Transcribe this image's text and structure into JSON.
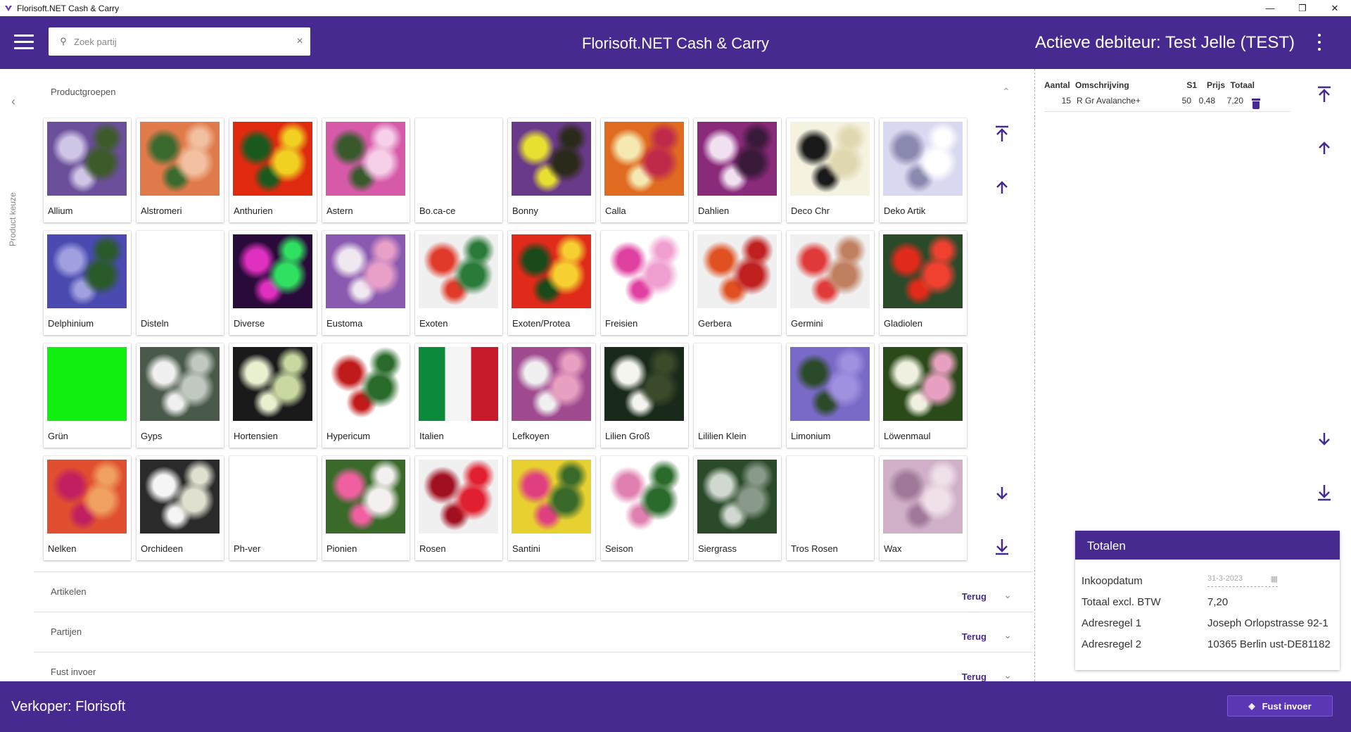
{
  "window": {
    "title": "Florisoft.NET Cash & Carry",
    "minimize": "—",
    "restore": "❐",
    "close": "✕"
  },
  "header": {
    "search_placeholder": "Zoek partij",
    "app_title": "Florisoft.NET Cash & Carry",
    "debiteur": "Actieve debiteur:  Test Jelle (TEST)"
  },
  "left_rail": {
    "label": "Product keuze"
  },
  "productgroepen": {
    "title": "Productgroepen",
    "groups": [
      {
        "label": "Allium",
        "thumb": "allium",
        "colors": [
          "#6b4f9a",
          "#cfc6e6",
          "#3d5a2a"
        ]
      },
      {
        "label": "Alstromeri",
        "thumb": "alstromeri",
        "colors": [
          "#e07a4a",
          "#3a6a2e",
          "#f2c0a0"
        ]
      },
      {
        "label": "Anthurien",
        "thumb": "anthurien",
        "colors": [
          "#e02a10",
          "#1a5a1e",
          "#f0d020"
        ]
      },
      {
        "label": "Astern",
        "thumb": "astern",
        "colors": [
          "#d65aa8",
          "#3a5a2e",
          "#f5d0e8"
        ]
      },
      {
        "label": "Bo.ca-ce",
        "thumb": "",
        "colors": []
      },
      {
        "label": "Bonny",
        "thumb": "bonny",
        "colors": [
          "#6a3a8a",
          "#e8e030",
          "#2a2a1a"
        ]
      },
      {
        "label": "Calla",
        "thumb": "calla",
        "colors": [
          "#e06a20",
          "#f5e8b0",
          "#c02a4a"
        ]
      },
      {
        "label": "Dahlien",
        "thumb": "dahlien",
        "colors": [
          "#8a2a7a",
          "#f0e0f0",
          "#3a1a3a"
        ]
      },
      {
        "label": "Deco Chr",
        "thumb": "decochr",
        "colors": [
          "#f5f2e0",
          "#1a1a1a",
          "#e0d8b0"
        ]
      },
      {
        "label": "Deko Artik",
        "thumb": "dekoartik",
        "colors": [
          "#d8d8f0",
          "#8a8ab0",
          "#ffffff"
        ]
      },
      {
        "label": "Delphinium",
        "thumb": "delphinium",
        "colors": [
          "#4a4ab0",
          "#a0a0e0",
          "#2a5a2a"
        ]
      },
      {
        "label": "Disteln",
        "thumb": "",
        "colors": []
      },
      {
        "label": "Diverse",
        "thumb": "diverse",
        "colors": [
          "#2a0a3a",
          "#e030c0",
          "#30e060"
        ]
      },
      {
        "label": "Eustoma",
        "thumb": "eustoma",
        "colors": [
          "#8a5ab0",
          "#f0e8f0",
          "#e8a0c8"
        ]
      },
      {
        "label": "Exoten",
        "thumb": "exoten",
        "colors": [
          "#f0f0f0",
          "#e03a2a",
          "#2a7a3a"
        ]
      },
      {
        "label": "Exoten/Protea",
        "thumb": "exotenprotea",
        "colors": [
          "#e02a1a",
          "#1a4a1a",
          "#f5d030"
        ]
      },
      {
        "label": "Freisien",
        "thumb": "freisien",
        "colors": [
          "#ffffff",
          "#e040a0",
          "#f0a0d0"
        ]
      },
      {
        "label": "Gerbera",
        "thumb": "gerbera",
        "colors": [
          "#f0f0f0",
          "#e05020",
          "#c02020"
        ]
      },
      {
        "label": "Germini",
        "thumb": "germini",
        "colors": [
          "#f0f0f0",
          "#e03a3a",
          "#c08060"
        ]
      },
      {
        "label": "Gladiolen",
        "thumb": "gladiolen",
        "colors": [
          "#2a4a2a",
          "#e02a1a",
          "#f04030"
        ]
      },
      {
        "label": "Grün",
        "thumb": "gruen",
        "colors": [
          "#10f010",
          "#10f010",
          "#10f010"
        ]
      },
      {
        "label": "Gyps",
        "thumb": "gyps",
        "colors": [
          "#4a5a4a",
          "#f0f0f0",
          "#c0c8c0"
        ]
      },
      {
        "label": "Hortensien",
        "thumb": "hortensien",
        "colors": [
          "#1a1a1a",
          "#e8f0d0",
          "#c8d8a0"
        ]
      },
      {
        "label": "Hypericum",
        "thumb": "hypericum",
        "colors": [
          "#ffffff",
          "#c01a1a",
          "#2a6a2a"
        ]
      },
      {
        "label": "Italien",
        "thumb": "italien",
        "colors": [
          "#0a8a3a",
          "#f5f5f5",
          "#c81a2a"
        ]
      },
      {
        "label": "Lefkoyen",
        "thumb": "lefkoyen",
        "colors": [
          "#a04a90",
          "#f0f0f0",
          "#e8a0c0"
        ]
      },
      {
        "label": "Lilien Groß",
        "thumb": "lilien",
        "colors": [
          "#1a2a1a",
          "#f5f5f0",
          "#3a4a2a"
        ]
      },
      {
        "label": "Lililien Klein",
        "thumb": "",
        "colors": []
      },
      {
        "label": "Limonium",
        "thumb": "limonium",
        "colors": [
          "#7a6ac8",
          "#2a4a2a",
          "#a090e0"
        ]
      },
      {
        "label": "Löwenmaul",
        "thumb": "loewenmaul",
        "colors": [
          "#2a4a1a",
          "#f0f0e0",
          "#e8a0c0"
        ]
      },
      {
        "label": "Nelken",
        "thumb": "nelken",
        "colors": [
          "#e05030",
          "#c02060",
          "#f0a060"
        ]
      },
      {
        "label": "Orchideen",
        "thumb": "orchideen",
        "colors": [
          "#2a2a2a",
          "#f5f5f5",
          "#e0e0d0"
        ]
      },
      {
        "label": "Ph-ver",
        "thumb": "",
        "colors": []
      },
      {
        "label": "Pionien",
        "thumb": "pionien",
        "colors": [
          "#3a6a2a",
          "#f060a0",
          "#f5f0f0"
        ]
      },
      {
        "label": "Rosen",
        "thumb": "rosen",
        "colors": [
          "#f0f0f0",
          "#a01020",
          "#e02030"
        ]
      },
      {
        "label": "Santini",
        "thumb": "santini",
        "colors": [
          "#e8d030",
          "#e04080",
          "#3a6a2a"
        ]
      },
      {
        "label": "Seison",
        "thumb": "seison",
        "colors": [
          "#ffffff",
          "#e080b0",
          "#2a6a2a"
        ]
      },
      {
        "label": "Siergrass",
        "thumb": "siergrass",
        "colors": [
          "#2a4a2a",
          "#d0d8d0",
          "#8a9a8a"
        ]
      },
      {
        "label": "Tros Rosen",
        "thumb": "",
        "colors": []
      },
      {
        "label": "Wax",
        "thumb": "wax",
        "colors": [
          "#d0b0c8",
          "#a07898",
          "#f0e0ea"
        ]
      }
    ]
  },
  "accordions": [
    {
      "title": "Artikelen",
      "action": "Terug"
    },
    {
      "title": "Partijen",
      "action": "Terug"
    },
    {
      "title": "Fust invoer",
      "action": "Terug"
    }
  ],
  "order": {
    "headers": {
      "aantal": "Aantal",
      "omschrijving": "Omschrijving",
      "s1": "S1",
      "prijs": "Prijs",
      "totaal": "Totaal"
    },
    "rows": [
      {
        "aantal": "15",
        "omschrijving": "R Gr Avalanche+",
        "s1": "50",
        "prijs": "0,48",
        "totaal": "7,20"
      }
    ]
  },
  "totalen": {
    "title": "Totalen",
    "rows": [
      {
        "label": "Inkoopdatum",
        "value": "31-3-2023"
      },
      {
        "label": "Totaal excl. BTW",
        "value": "7,20"
      },
      {
        "label": "Adresregel 1",
        "value": "Joseph Orlopstrasse 92-1"
      },
      {
        "label": "Adresregel 2",
        "value": "10365 Berlin ust-DE81182"
      }
    ]
  },
  "footer": {
    "verkoper": "Verkoper:  Florisoft",
    "fust_button": "Fust invoer"
  },
  "icons": {
    "accent_color": "#472a8f",
    "nav_arrows": [
      "arrow-to-top-icon",
      "arrow-up-icon",
      "arrow-down-icon",
      "arrow-to-bottom-icon"
    ]
  }
}
